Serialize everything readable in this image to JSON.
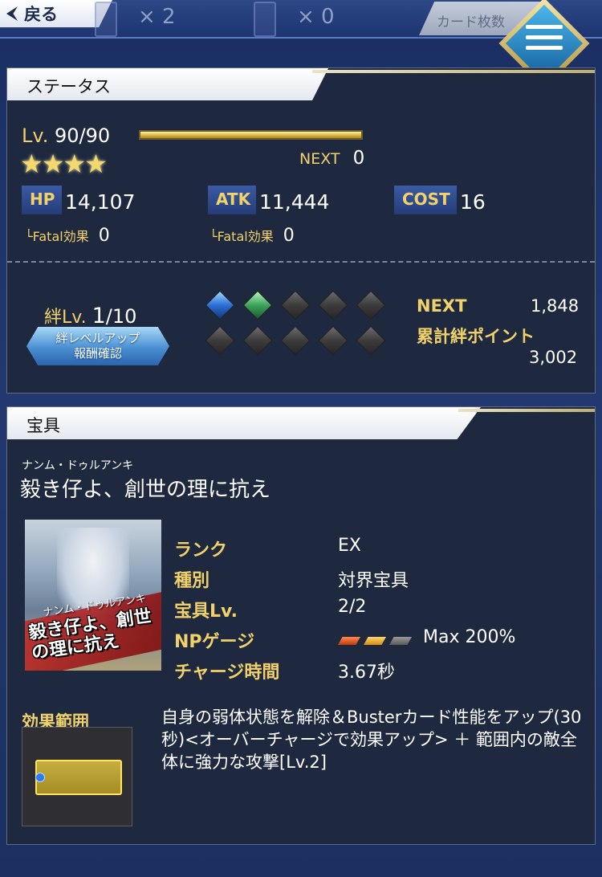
{
  "topbar": {
    "back_label": "戻る",
    "count_left": "× 2",
    "count_right": "× 0",
    "sort_label": "カード枚数",
    "menu_icon": "hamburger-icon"
  },
  "status": {
    "header": "ステータス",
    "level_label": "Lv.",
    "level_value": "90/90",
    "exp_progress": 1.0,
    "stars": "★★★★",
    "next_label": "NEXT",
    "next_value": "0",
    "hp_label": "HP",
    "hp_value": "14,107",
    "atk_label": "ATK",
    "atk_value": "11,444",
    "cost_label": "COST",
    "cost_value": "16",
    "fatal_label": "└Fatal効果",
    "hp_fatal_value": "0",
    "atk_fatal_value": "0",
    "bond_label": "絆Lv.",
    "bond_level": "1",
    "bond_max": "/10",
    "bond_button_line1": "絆レベルアップ",
    "bond_button_line2": "報酬確認",
    "bond_gems_filled": 2,
    "bond_gems_total": 10,
    "bond_next_label": "NEXT",
    "bond_next_value": "1,848",
    "bond_total_label": "累計絆ポイント",
    "bond_total_value": "3,002"
  },
  "noble": {
    "header": "宝具",
    "ruby": "ナンム・ドゥルアンキ",
    "name": "毅き仔よ、創世の理に抗え",
    "image_text_small": "ナンム・ドゥルアンキ",
    "image_text_large": "毅き仔よ、創世の理に抗え",
    "rank_label": "ランク",
    "rank_value": "EX",
    "type_label": "種別",
    "type_value": "対界宝具",
    "np_lv_label": "宝具Lv.",
    "np_lv_value": "2/2",
    "gauge_label": "NPゲージ",
    "gauge_value": "Max 200%",
    "charge_label": "チャージ時間",
    "charge_value": "3.67秒",
    "range_label": "効果範囲",
    "description": "自身の弱体状態を解除＆Busterカード性能をアップ(30秒)<オーバーチャージで効果アップ> ＋ 範囲内の敵全体に強力な攻撃[Lv.2]"
  },
  "colors": {
    "gold_text": "#f1d26a",
    "panel_bg": "#1e283e",
    "page_bg": "#22386f"
  }
}
